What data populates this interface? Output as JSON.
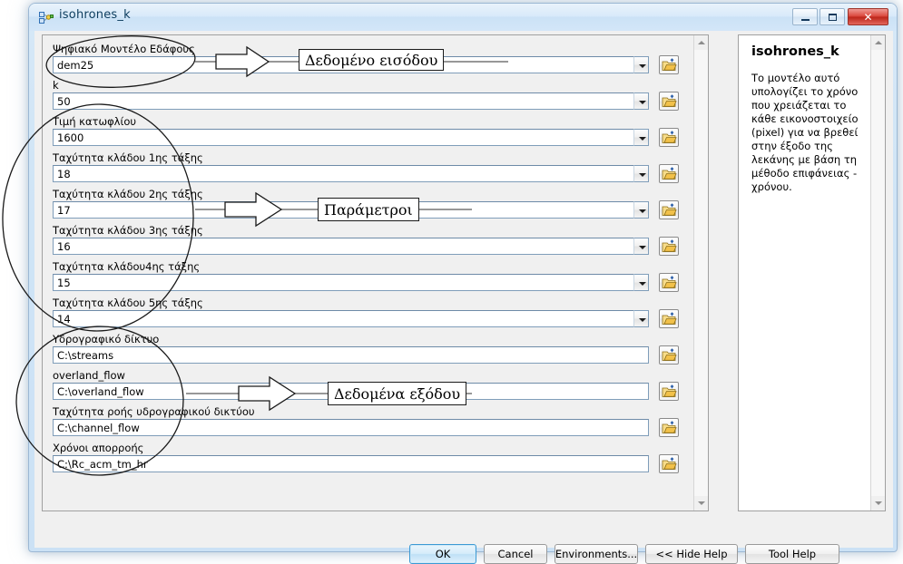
{
  "window": {
    "title": "isohrones_k",
    "icon": "model-tool-icon",
    "caption_buttons": {
      "minimize": "Minimize",
      "maximize": "Maximize",
      "close": "Close"
    }
  },
  "parameters": [
    {
      "label": "Ψηφιακό Μοντέλο Εδάφους",
      "value": "dem25",
      "type": "combo"
    },
    {
      "label": "k",
      "value": "50",
      "type": "combo"
    },
    {
      "label": "Τιμή κατωφλίου",
      "value": "1600",
      "type": "combo"
    },
    {
      "label": "Ταχύτητα κλάδου  1ης τάξης",
      "value": "18",
      "type": "combo"
    },
    {
      "label": "Ταχύτητα κλάδου 2ης τάξης",
      "value": "17",
      "type": "combo"
    },
    {
      "label": "Ταχύτητα κλάδου  3ης τάξης",
      "value": "16",
      "type": "combo"
    },
    {
      "label": "Ταχύτητα κλάδου4ης τάξης",
      "value": "15",
      "type": "combo"
    },
    {
      "label": "Ταχύτητα κλάδου  5ης τάξης",
      "value": "14",
      "type": "combo"
    },
    {
      "label": "Υδρογραφικό δίκτυο",
      "value": "C:\\streams",
      "type": "plain"
    },
    {
      "label": "overland_flow",
      "value": "C:\\overland_flow",
      "type": "plain"
    },
    {
      "label": "Ταχύτητα ροής υδρογραφικού δικτύου",
      "value": "C:\\channel_flow",
      "type": "plain"
    },
    {
      "label": "Χρόνοι απορροής",
      "value": "C:\\Rc_acm_tm_hr",
      "type": "plain"
    }
  ],
  "help": {
    "title": "isohrones_k",
    "body": "Το μοντέλο αυτό υπολογίζει το χρόνο που χρειάζεται το κάθε εικονοστοιχείο (pixel) για να βρεθεί στην έξοδο της λεκάνης με βάση τη μέθοδο επιφάνειας - χρόνου."
  },
  "buttons": {
    "ok": "OK",
    "cancel": "Cancel",
    "environments": "Environments...",
    "hide_help": "<< Hide Help",
    "tool_help": "Tool Help"
  },
  "annotations": [
    {
      "label": "Δεδομένο εισόδου"
    },
    {
      "label": "Παράμετροι"
    },
    {
      "label": "Δεδομένα εξόδου"
    }
  ],
  "colors": {
    "frame": "#cfe4f6",
    "client_bg": "#f0f0f0",
    "field_border": "#7f9db9",
    "close_button": "#d9453a",
    "ok_accent": "#3c9ad4",
    "folder_icon": "#f2c14a",
    "annotation_ink": "#1a1a1a"
  }
}
